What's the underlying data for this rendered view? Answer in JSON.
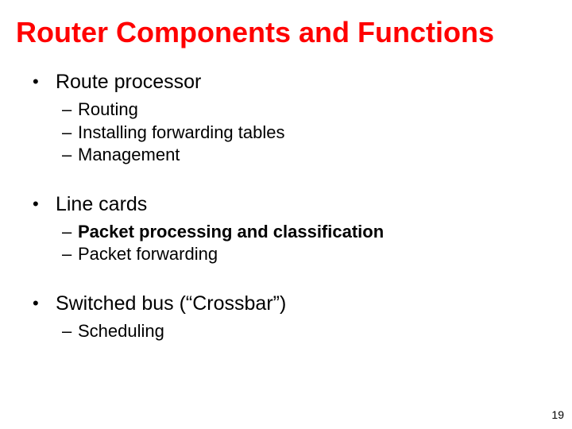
{
  "title": "Router Components and Functions",
  "bullets": [
    {
      "label": "Route processor",
      "subitems": [
        {
          "label": "Routing",
          "bold": false
        },
        {
          "label": "Installing forwarding tables",
          "bold": false
        },
        {
          "label": "Management",
          "bold": false
        }
      ]
    },
    {
      "label": "Line cards",
      "subitems": [
        {
          "label": "Packet processing and classification",
          "bold": true
        },
        {
          "label": "Packet forwarding",
          "bold": false
        }
      ]
    },
    {
      "label": "Switched bus (“Crossbar”)",
      "subitems": [
        {
          "label": "Scheduling",
          "bold": false
        }
      ]
    }
  ],
  "page_number": "19"
}
